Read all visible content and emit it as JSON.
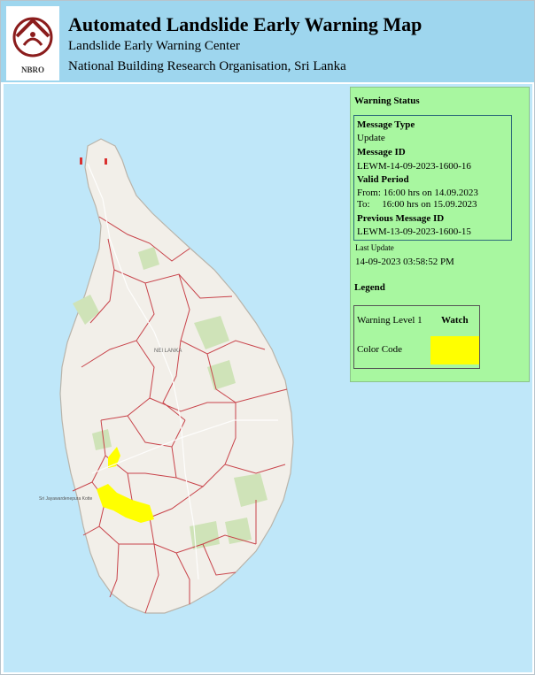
{
  "header": {
    "logo_text": "NBRO",
    "title": "Automated Landslide Early Warning Map",
    "subtitle1": "Landslide Early Warning Center",
    "subtitle2": "National Building Research Organisation, Sri Lanka"
  },
  "map": {
    "label_kilinochchi": "",
    "label_sri_lanka": "NEI LANKA",
    "label_colombo": "Sri Jayawardenepura Kotte",
    "warning_color": "#ffff00",
    "land_color": "#f2efe9",
    "water_color": "#bfe7f9",
    "boundary_color": "#c8434a"
  },
  "panel": {
    "title": "Warning Status",
    "message_type_label": "Message Type",
    "message_type": "Update",
    "message_id_label": "Message ID",
    "message_id": "LEWM-14-09-2023-1600-16",
    "valid_period_label": "Valid Period",
    "from_line": "From: 16:00 hrs on 14.09.2023",
    "to_line": "To:     16:00 hrs on 15.09.2023",
    "previous_label": "Previous Message ID",
    "previous_id": "LEWM-13-09-2023-1600-15",
    "last_update_label": "Last Update",
    "last_update": "14-09-2023 03:58:52 PM",
    "legend_title": "Legend",
    "warning_level": "Warning Level 1",
    "watch": "Watch",
    "color_code": "Color Code",
    "watch_color": "#ffff00"
  }
}
